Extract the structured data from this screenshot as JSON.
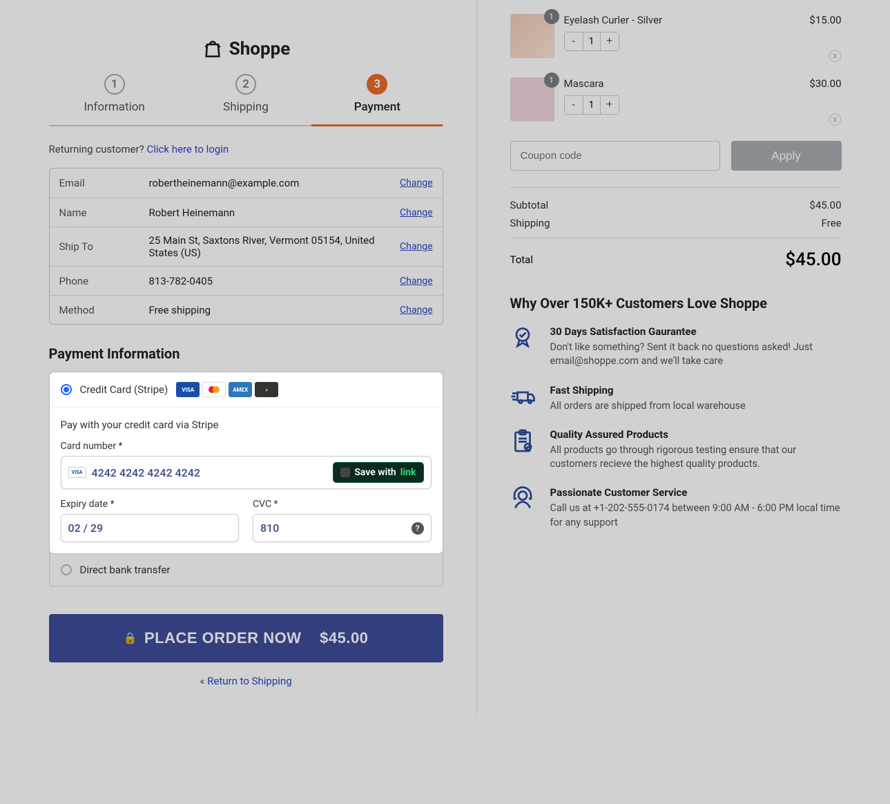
{
  "brand": "Shoppe",
  "steps": {
    "s1": {
      "num": "1",
      "label": "Information"
    },
    "s2": {
      "num": "2",
      "label": "Shipping"
    },
    "s3": {
      "num": "3",
      "label": "Payment"
    }
  },
  "returning": {
    "text": "Returning customer? ",
    "link": "Click here to login"
  },
  "info": {
    "email": {
      "label": "Email",
      "value": "robertheinemann@example.com",
      "change": "Change"
    },
    "name": {
      "label": "Name",
      "value": "Robert Heinemann",
      "change": "Change"
    },
    "ship": {
      "label": "Ship To",
      "value": "25 Main St, Saxtons River, Vermont 05154, United States (US)",
      "change": "Change"
    },
    "phone": {
      "label": "Phone",
      "value": "813-782-0405",
      "change": "Change"
    },
    "method": {
      "label": "Method",
      "value": "Free shipping",
      "change": "Change"
    }
  },
  "payment": {
    "heading": "Payment Information",
    "stripe": {
      "label": "Credit Card (Stripe)",
      "desc": "Pay with your credit card via Stripe",
      "card_label": "Card number *",
      "card_value": "4242 4242 4242 4242",
      "save_text": "Save with ",
      "save_brand": "link",
      "exp_label": "Expiry date *",
      "exp_value": "02 / 29",
      "cvc_label": "CVC *",
      "cvc_value": "810"
    },
    "dbt": {
      "label": "Direct bank transfer"
    }
  },
  "place_order": {
    "text": "PLACE ORDER NOW",
    "amount": "$45.00"
  },
  "return_link": "« Return to Shipping",
  "cart": {
    "items": [
      {
        "title": "Eyelash Curler - Silver",
        "qty": "1",
        "price": "$15.00"
      },
      {
        "title": "Mascara",
        "qty": "1",
        "price": "$30.00"
      }
    ],
    "coupon_placeholder": "Coupon code",
    "apply": "Apply",
    "subtotal": {
      "label": "Subtotal",
      "value": "$45.00"
    },
    "shipping": {
      "label": "Shipping",
      "value": "Free"
    },
    "total": {
      "label": "Total",
      "value": "$45.00"
    }
  },
  "why": {
    "heading": "Why Over 150K+ Customers Love Shoppe",
    "f1": {
      "title": "30 Days Satisfaction Gaurantee",
      "body": "Don't like something? Sent it back no questions asked! Just email@shoppe.com and we'll take care"
    },
    "f2": {
      "title": "Fast Shipping",
      "body": "All orders are shipped from local warehouse"
    },
    "f3": {
      "title": "Quality Assured Products",
      "body": "All products go through rigorous testing ensure that our customers recieve the highest quality products."
    },
    "f4": {
      "title": "Passionate Customer Service",
      "body": "Call us at +1-202-555-0174 between 9:00 AM - 6:00 PM local time for any support"
    }
  }
}
